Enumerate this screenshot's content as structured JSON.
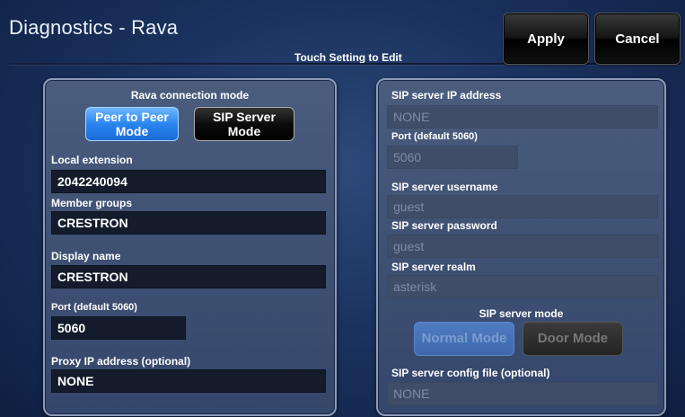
{
  "header": {
    "title": "Diagnostics - Rava",
    "subtitle": "Touch Setting to Edit",
    "apply_label": "Apply",
    "cancel_label": "Cancel"
  },
  "left_panel": {
    "connection_mode_label": "Rava connection mode",
    "peer_button_label": "Peer to Peer\nMode",
    "sip_button_label": "SIP Server\nMode",
    "selected_mode": "Peer to Peer Mode",
    "local_extension_label": "Local extension",
    "local_extension_value": "2042240094",
    "member_groups_label": "Member groups",
    "member_groups_value": "CRESTRON",
    "display_name_label": "Display name",
    "display_name_value": "CRESTRON",
    "port_label": "Port (default 5060)",
    "port_value": "5060",
    "proxy_label": "Proxy IP address (optional)",
    "proxy_value": "NONE"
  },
  "right_panel": {
    "sip_ip_label": "SIP server IP address",
    "sip_ip_value": "NONE",
    "port_label": "Port (default 5060)",
    "port_value": "5060",
    "username_label": "SIP server username",
    "username_value": "guest",
    "password_label": "SIP server password",
    "password_value": "guest",
    "realm_label": "SIP server realm",
    "realm_value": "asterisk",
    "sip_mode_label": "SIP server mode",
    "normal_mode_label": "Normal Mode",
    "door_mode_label": "Door Mode",
    "config_file_label": "SIP server config file (optional)",
    "config_file_value": "NONE",
    "disabled": true
  },
  "colors": {
    "background": "#1b3360",
    "active_button": "#2a85ee",
    "field_background": "#141c2c",
    "disabled_field": "#3f4d68"
  }
}
